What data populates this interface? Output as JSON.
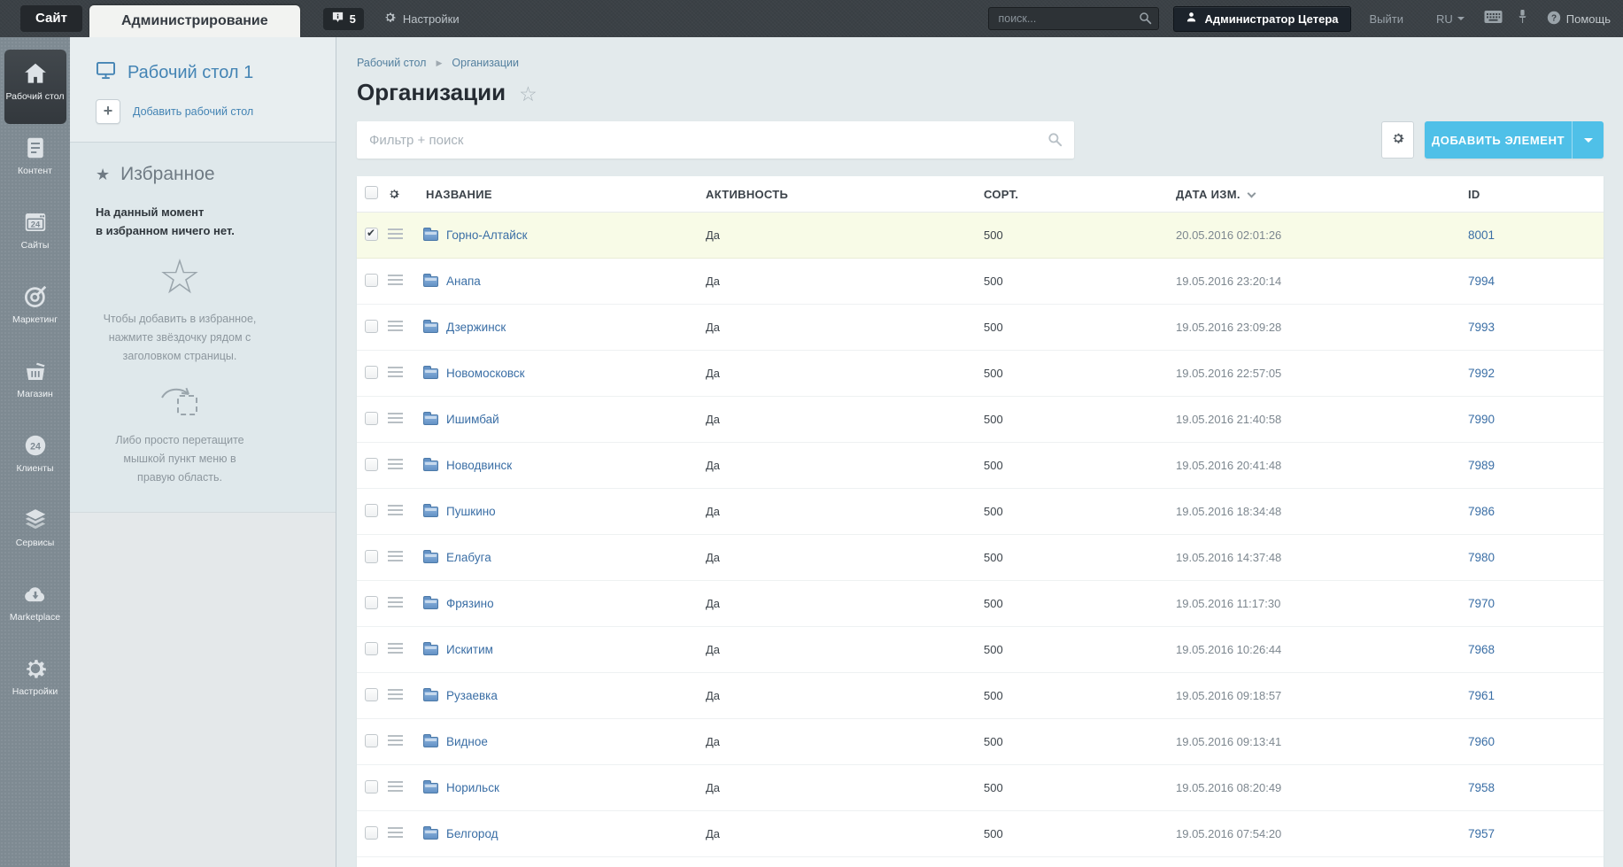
{
  "topbar": {
    "site_tab": "Сайт",
    "admin_tab": "Администрирование",
    "notifications_count": "5",
    "settings_label": "Настройки",
    "search_placeholder": "поиск...",
    "user_name": "Администратор Цетера",
    "logout_label": "Выйти",
    "lang_label": "RU",
    "help_label": "Помощь"
  },
  "sidebar": {
    "items": [
      {
        "key": "desktop",
        "label": "Рабочий стол",
        "icon": "home-icon",
        "active": true
      },
      {
        "key": "content",
        "label": "Контент",
        "icon": "document-icon",
        "active": false
      },
      {
        "key": "sites",
        "label": "Сайты",
        "icon": "browser-24-icon",
        "active": false
      },
      {
        "key": "marketing",
        "label": "Маркетинг",
        "icon": "target-icon",
        "active": false
      },
      {
        "key": "shop",
        "label": "Магазин",
        "icon": "basket-icon",
        "active": false
      },
      {
        "key": "clients",
        "label": "Клиенты",
        "icon": "clients-24-icon",
        "active": false
      },
      {
        "key": "services",
        "label": "Сервисы",
        "icon": "layers-icon",
        "active": false
      },
      {
        "key": "marketplace",
        "label": "Marketplace",
        "icon": "cloud-download-icon",
        "active": false
      },
      {
        "key": "settings",
        "label": "Настройки",
        "icon": "gear-icon",
        "active": false
      }
    ]
  },
  "desktop_panel": {
    "title": "Рабочий стол 1",
    "add_desktop_label": "Добавить рабочий стол",
    "favorites": {
      "title": "Избранное",
      "empty_text": "На данный момент\nв избранном ничего нет.",
      "hint_star": "Чтобы добавить в избранное,\nнажмите звёздочку рядом с\nзаголовком страницы.",
      "hint_drag": "Либо просто перетащите\nмышкой пункт меню в\nправую область."
    }
  },
  "main": {
    "breadcrumb": {
      "root": "Рабочий стол",
      "current": "Организации"
    },
    "page_title": "Организации",
    "filter_placeholder": "Фильтр + поиск",
    "add_button_label": "ДОБАВИТЬ ЭЛЕМЕНТ",
    "table": {
      "columns": {
        "name": "НАЗВАНИЕ",
        "active": "АКТИВНОСТЬ",
        "sort": "СОРТ.",
        "modified": "ДАТА ИЗМ.",
        "id": "ID"
      },
      "rows": [
        {
          "name": "Горно-Алтайск",
          "active": "Да",
          "sort": "500",
          "modified": "20.05.2016 02:01:26",
          "id": "8001",
          "selected": true
        },
        {
          "name": "Анапа",
          "active": "Да",
          "sort": "500",
          "modified": "19.05.2016 23:20:14",
          "id": "7994",
          "selected": false
        },
        {
          "name": "Дзержинск",
          "active": "Да",
          "sort": "500",
          "modified": "19.05.2016 23:09:28",
          "id": "7993",
          "selected": false
        },
        {
          "name": "Новомосковск",
          "active": "Да",
          "sort": "500",
          "modified": "19.05.2016 22:57:05",
          "id": "7992",
          "selected": false
        },
        {
          "name": "Ишимбай",
          "active": "Да",
          "sort": "500",
          "modified": "19.05.2016 21:40:58",
          "id": "7990",
          "selected": false
        },
        {
          "name": "Новодвинск",
          "active": "Да",
          "sort": "500",
          "modified": "19.05.2016 20:41:48",
          "id": "7989",
          "selected": false
        },
        {
          "name": "Пушкино",
          "active": "Да",
          "sort": "500",
          "modified": "19.05.2016 18:34:48",
          "id": "7986",
          "selected": false
        },
        {
          "name": "Елабуга",
          "active": "Да",
          "sort": "500",
          "modified": "19.05.2016 14:37:48",
          "id": "7980",
          "selected": false
        },
        {
          "name": "Фрязино",
          "active": "Да",
          "sort": "500",
          "modified": "19.05.2016 11:17:30",
          "id": "7970",
          "selected": false
        },
        {
          "name": "Искитим",
          "active": "Да",
          "sort": "500",
          "modified": "19.05.2016 10:26:44",
          "id": "7968",
          "selected": false
        },
        {
          "name": "Рузаевка",
          "active": "Да",
          "sort": "500",
          "modified": "19.05.2016 09:18:57",
          "id": "7961",
          "selected": false
        },
        {
          "name": "Видное",
          "active": "Да",
          "sort": "500",
          "modified": "19.05.2016 09:13:41",
          "id": "7960",
          "selected": false
        },
        {
          "name": "Норильск",
          "active": "Да",
          "sort": "500",
          "modified": "19.05.2016 08:20:49",
          "id": "7958",
          "selected": false
        },
        {
          "name": "Белгород",
          "active": "Да",
          "sort": "500",
          "modified": "19.05.2016 07:54:20",
          "id": "7957",
          "selected": false
        }
      ]
    }
  },
  "colors": {
    "accent_blue": "#4fc0e8",
    "link_blue": "#3a6ea5",
    "selected_row_bg": "#f8fbe7",
    "topbar_bg": "#3b4146",
    "sidebar_bg": "#7e8a92"
  }
}
